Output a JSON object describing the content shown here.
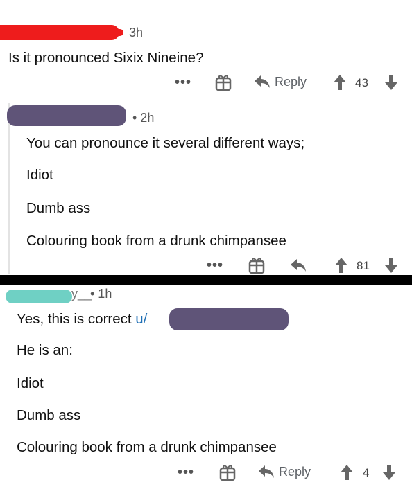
{
  "comment1": {
    "time": "3h",
    "text": "Is it pronounced Sixix Nineine?",
    "reply_label": "Reply",
    "votes": "43",
    "more": "•••"
  },
  "comment2": {
    "time": "• 2h",
    "lines": [
      "You can pronounce it several different ways;",
      "Idiot",
      "Dumb ass",
      "Colouring book from a drunk chimpansee"
    ],
    "votes": "81",
    "more": "•••"
  },
  "comment3": {
    "time": "• 1h",
    "username_fragment": "y__",
    "line1_prefix": "Yes, this is correct ",
    "mention_prefix": "u/",
    "lines": [
      "He is an:",
      "Idiot",
      "Dumb ass",
      "Colouring book from a drunk chimpansee"
    ],
    "reply_label": "Reply",
    "votes": "4",
    "more": "•••"
  },
  "colors": {
    "redact_red": "#ee1c1c",
    "redact_purple": "#5f5478",
    "redact_teal": "#6fd0c4",
    "mention_link": "#1f6fb5"
  }
}
